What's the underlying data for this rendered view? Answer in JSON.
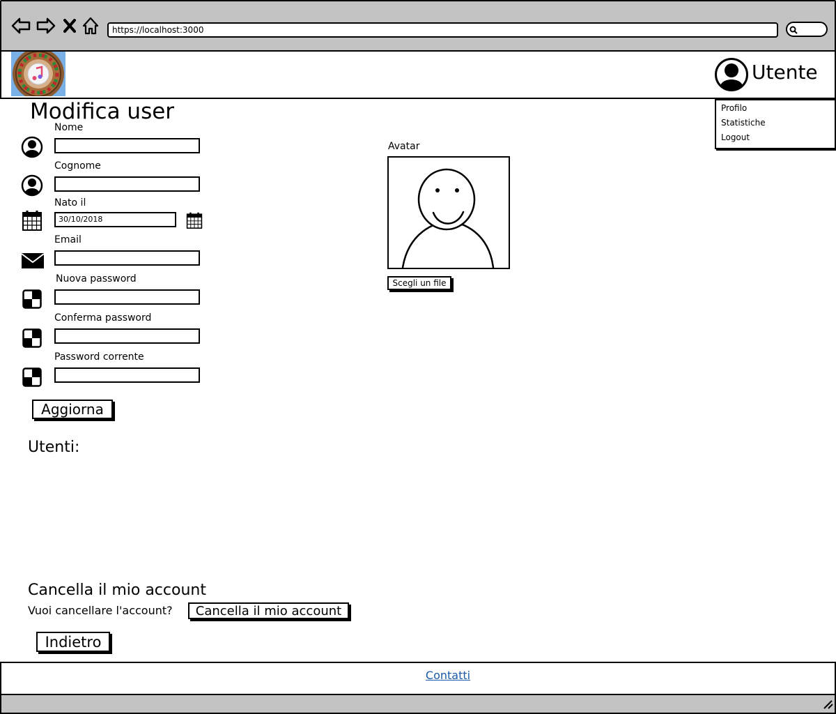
{
  "browser": {
    "url": "https://localhost:3000"
  },
  "header": {
    "user_label": "Utente",
    "menu": [
      "Profilo",
      "Statistiche",
      "Logout"
    ]
  },
  "form": {
    "title": "Modifica user",
    "fields": {
      "nome": {
        "label": "Nome",
        "value": ""
      },
      "cognome": {
        "label": "Cognome",
        "value": ""
      },
      "nato_il": {
        "label": "Nato il",
        "value": "30/10/2018"
      },
      "email": {
        "label": "Email",
        "value": ""
      },
      "nuova_password": {
        "label": "Nuova password",
        "value": ""
      },
      "conferma_password": {
        "label": "Conferma password",
        "value": ""
      },
      "password_corrente": {
        "label": "Password corrente",
        "value": ""
      }
    },
    "submit_label": "Aggiorna"
  },
  "avatar": {
    "label": "Avatar",
    "choose_file_label": "Scegli un file"
  },
  "users": {
    "heading": "Utenti:"
  },
  "delete_account": {
    "heading": "Cancella il mio account",
    "question": "Vuoi cancellare l'account?",
    "button_label": "Cancella il mio account"
  },
  "back_label": "Indietro",
  "footer": {
    "link_label": "Contatti"
  }
}
